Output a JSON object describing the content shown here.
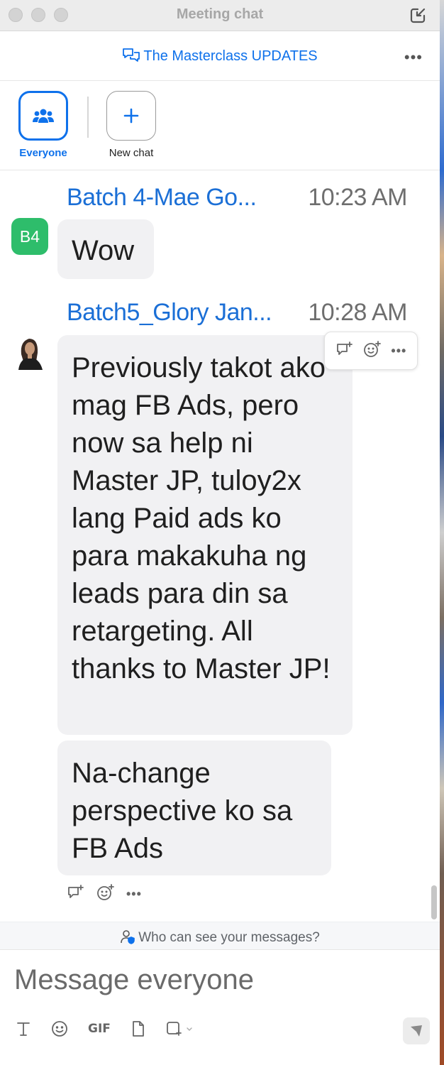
{
  "window": {
    "title": "Meeting chat"
  },
  "header": {
    "channel_title": "The Masterclass UPDATES"
  },
  "recipients": {
    "everyone_label": "Everyone",
    "new_chat_label": "New chat"
  },
  "messages": [
    {
      "sender": "Batch 4-Mae Go...",
      "time": "10:23 AM",
      "avatar_initials": "B4",
      "bubbles": [
        "Wow"
      ]
    },
    {
      "sender": "Batch5_Glory Jan...",
      "time": "10:28 AM",
      "bubbles": [
        "Previously takot ako mag FB Ads, pero now sa help ni Master JP, tuloy2x lang Paid ads ko para makakuha ng leads para din sa retargeting. All thanks to Master JP!",
        "Na-change perspective ko sa FB Ads"
      ]
    }
  ],
  "privacy": {
    "text": "Who can see your messages?"
  },
  "composer": {
    "placeholder": "Message everyone",
    "gif_label": "GIF"
  },
  "colors": {
    "accent": "#0e71eb",
    "sender_name": "#1b6fd6",
    "avatar_b4": "#2ebd6b",
    "bubble_bg": "#f1f1f3"
  }
}
